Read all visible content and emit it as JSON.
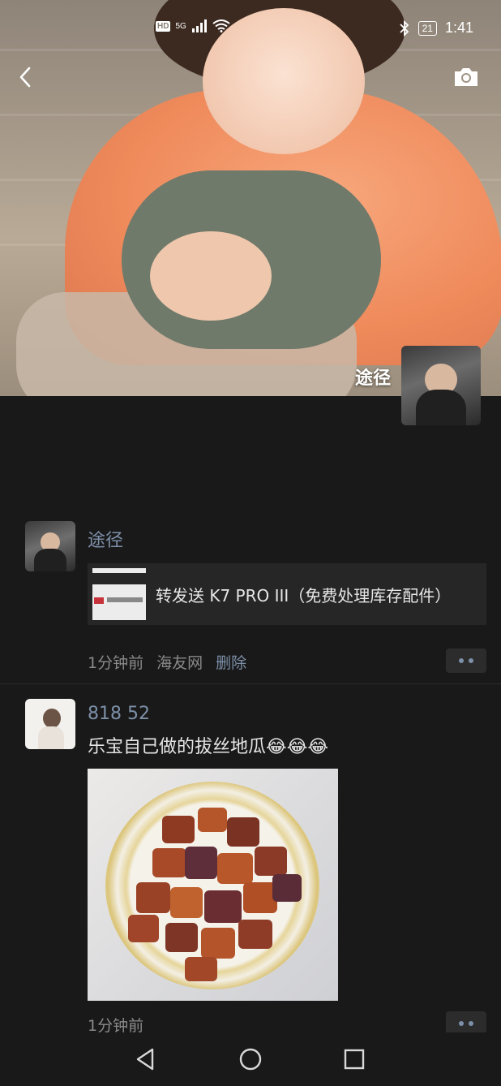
{
  "status_bar": {
    "hd": "HD",
    "network": "5G",
    "battery": "21",
    "time": "1:41"
  },
  "header": {
    "owner_name": "途径"
  },
  "posts": [
    {
      "name": "途径",
      "link_title": "转发送 K7 PRO III（免费处理库存配件）",
      "time": "1分钟前",
      "source": "海友网",
      "delete_label": "删除"
    },
    {
      "name": "818  52",
      "text": "乐宝自己做的拔丝地瓜😂😂😂",
      "time": "1分钟前"
    }
  ],
  "colors": {
    "background": "#191919",
    "name_link": "#7d90a9",
    "meta_text": "#8a8a8a"
  },
  "icons": [
    "back-icon",
    "camera-icon",
    "signal-icon",
    "wifi-icon",
    "bluetooth-icon",
    "battery-icon",
    "nav-back-icon",
    "nav-home-icon",
    "nav-recents-icon"
  ]
}
